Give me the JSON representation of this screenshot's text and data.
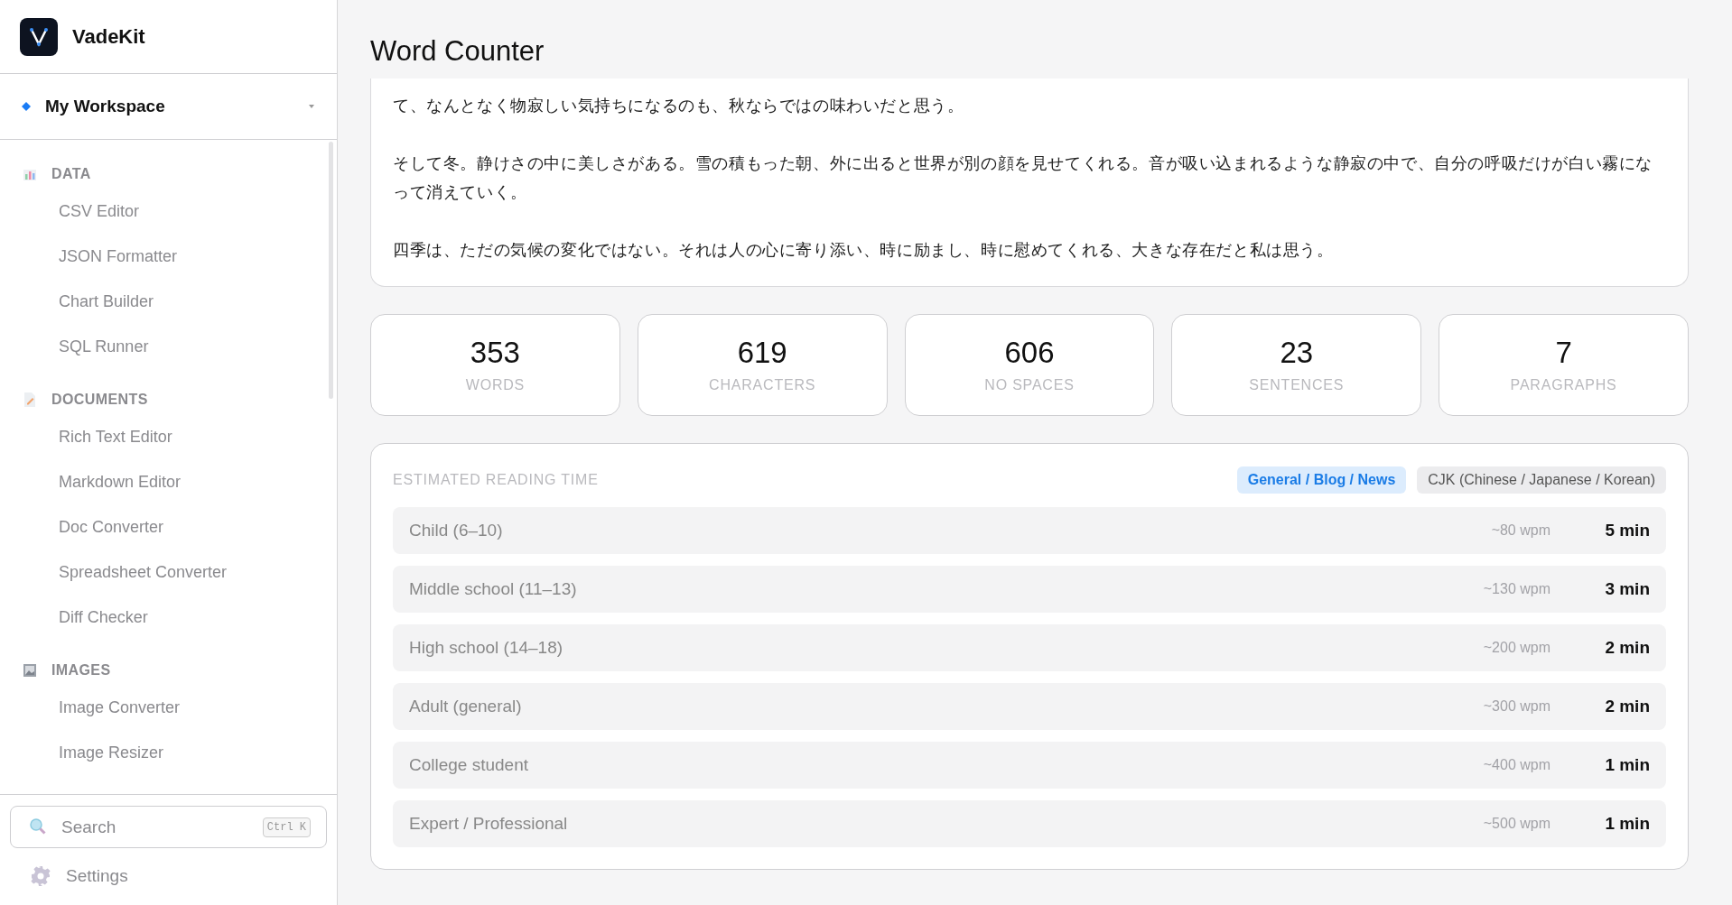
{
  "app": {
    "name": "VadeKit"
  },
  "workspace": {
    "name": "My Workspace"
  },
  "sidebar": {
    "sections": [
      {
        "kind": "chart",
        "title": "DATA",
        "items": [
          "CSV Editor",
          "JSON Formatter",
          "Chart Builder",
          "SQL Runner"
        ]
      },
      {
        "kind": "document",
        "title": "DOCUMENTS",
        "items": [
          "Rich Text Editor",
          "Markdown Editor",
          "Doc Converter",
          "Spreadsheet Converter",
          "Diff Checker"
        ]
      },
      {
        "kind": "image",
        "title": "IMAGES",
        "items": [
          "Image Converter",
          "Image Resizer"
        ]
      }
    ]
  },
  "search": {
    "placeholder": "Search",
    "shortcut": "Ctrl K"
  },
  "settings": {
    "label": "Settings"
  },
  "page": {
    "title": "Word Counter"
  },
  "text_paragraphs": [
    "て、なんとなく物寂しい気持ちになるのも、秋ならではの味わいだと思う。",
    "そして冬。静けさの中に美しさがある。雪の積もった朝、外に出ると世界が別の顔を見せてくれる。音が吸い込まれるような静寂の中で、自分の呼吸だけが白い霧になって消えていく。",
    "四季は、ただの気候の変化ではない。それは人の心に寄り添い、時に励まし、時に慰めてくれる、大きな存在だと私は思う。"
  ],
  "stats": [
    {
      "value": "353",
      "label": "WORDS"
    },
    {
      "value": "619",
      "label": "CHARACTERS"
    },
    {
      "value": "606",
      "label": "NO SPACES"
    },
    {
      "value": "23",
      "label": "SENTENCES"
    },
    {
      "value": "7",
      "label": "PARAGRAPHS"
    }
  ],
  "reading_time": {
    "title": "ESTIMATED READING TIME",
    "tabs": [
      {
        "label": "General / Blog / News",
        "selected": true
      },
      {
        "label": "CJK (Chinese / Japanese / Korean)",
        "selected": false
      }
    ],
    "rows": [
      {
        "label": "Child (6–10)",
        "rate": "~80 wpm",
        "time": "5 min"
      },
      {
        "label": "Middle school (11–13)",
        "rate": "~130 wpm",
        "time": "3 min"
      },
      {
        "label": "High school (14–18)",
        "rate": "~200 wpm",
        "time": "2 min"
      },
      {
        "label": "Adult (general)",
        "rate": "~300 wpm",
        "time": "2 min"
      },
      {
        "label": "College student",
        "rate": "~400 wpm",
        "time": "1 min"
      },
      {
        "label": "Expert / Professional",
        "rate": "~500 wpm",
        "time": "1 min"
      }
    ]
  }
}
